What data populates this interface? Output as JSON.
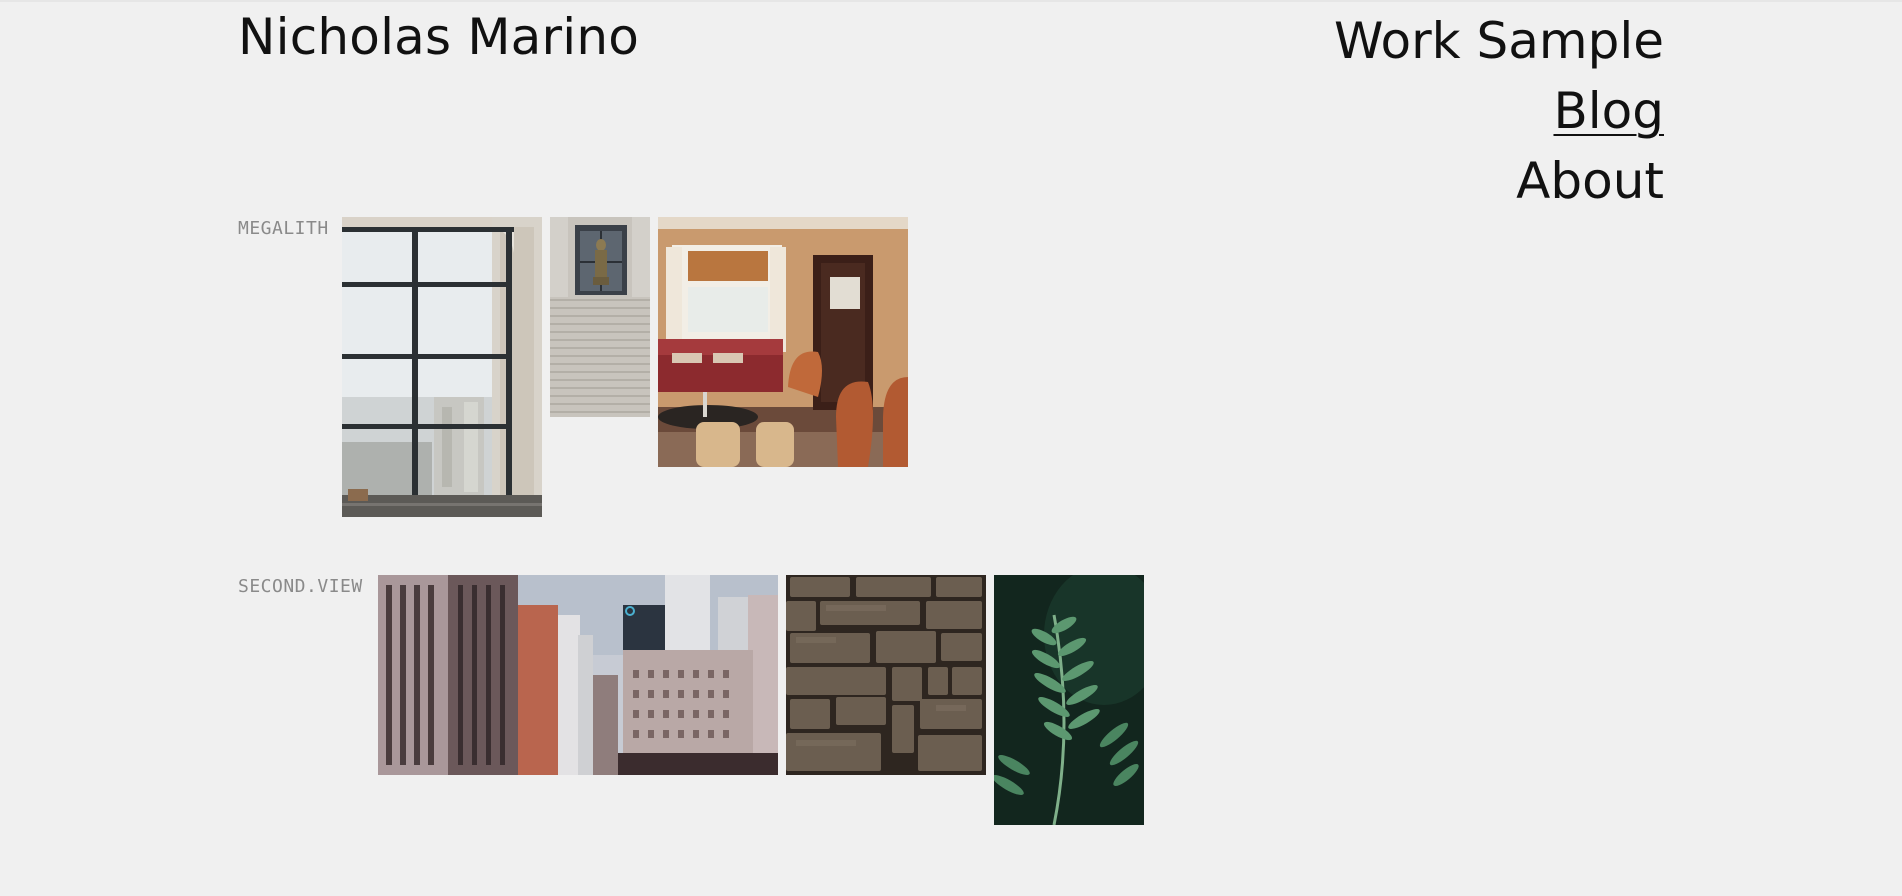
{
  "site": {
    "title": "Nicholas Marino"
  },
  "nav": {
    "items": [
      {
        "label": "Work Sample",
        "active": false
      },
      {
        "label": "Blog",
        "active": true
      },
      {
        "label": "About",
        "active": false
      }
    ]
  },
  "galleries": [
    {
      "label": "MEGALITH",
      "photos": [
        "window-loft-photo",
        "statue-stairs-photo",
        "lounge-interior-photo"
      ]
    },
    {
      "label": "SECOND.VIEW",
      "photos": [
        "city-buildings-photo",
        "stone-wall-photo",
        "fern-leaf-photo"
      ]
    }
  ],
  "colors": {
    "background": "#f0f0f0",
    "text": "#111111",
    "label": "#8a8a8a"
  }
}
